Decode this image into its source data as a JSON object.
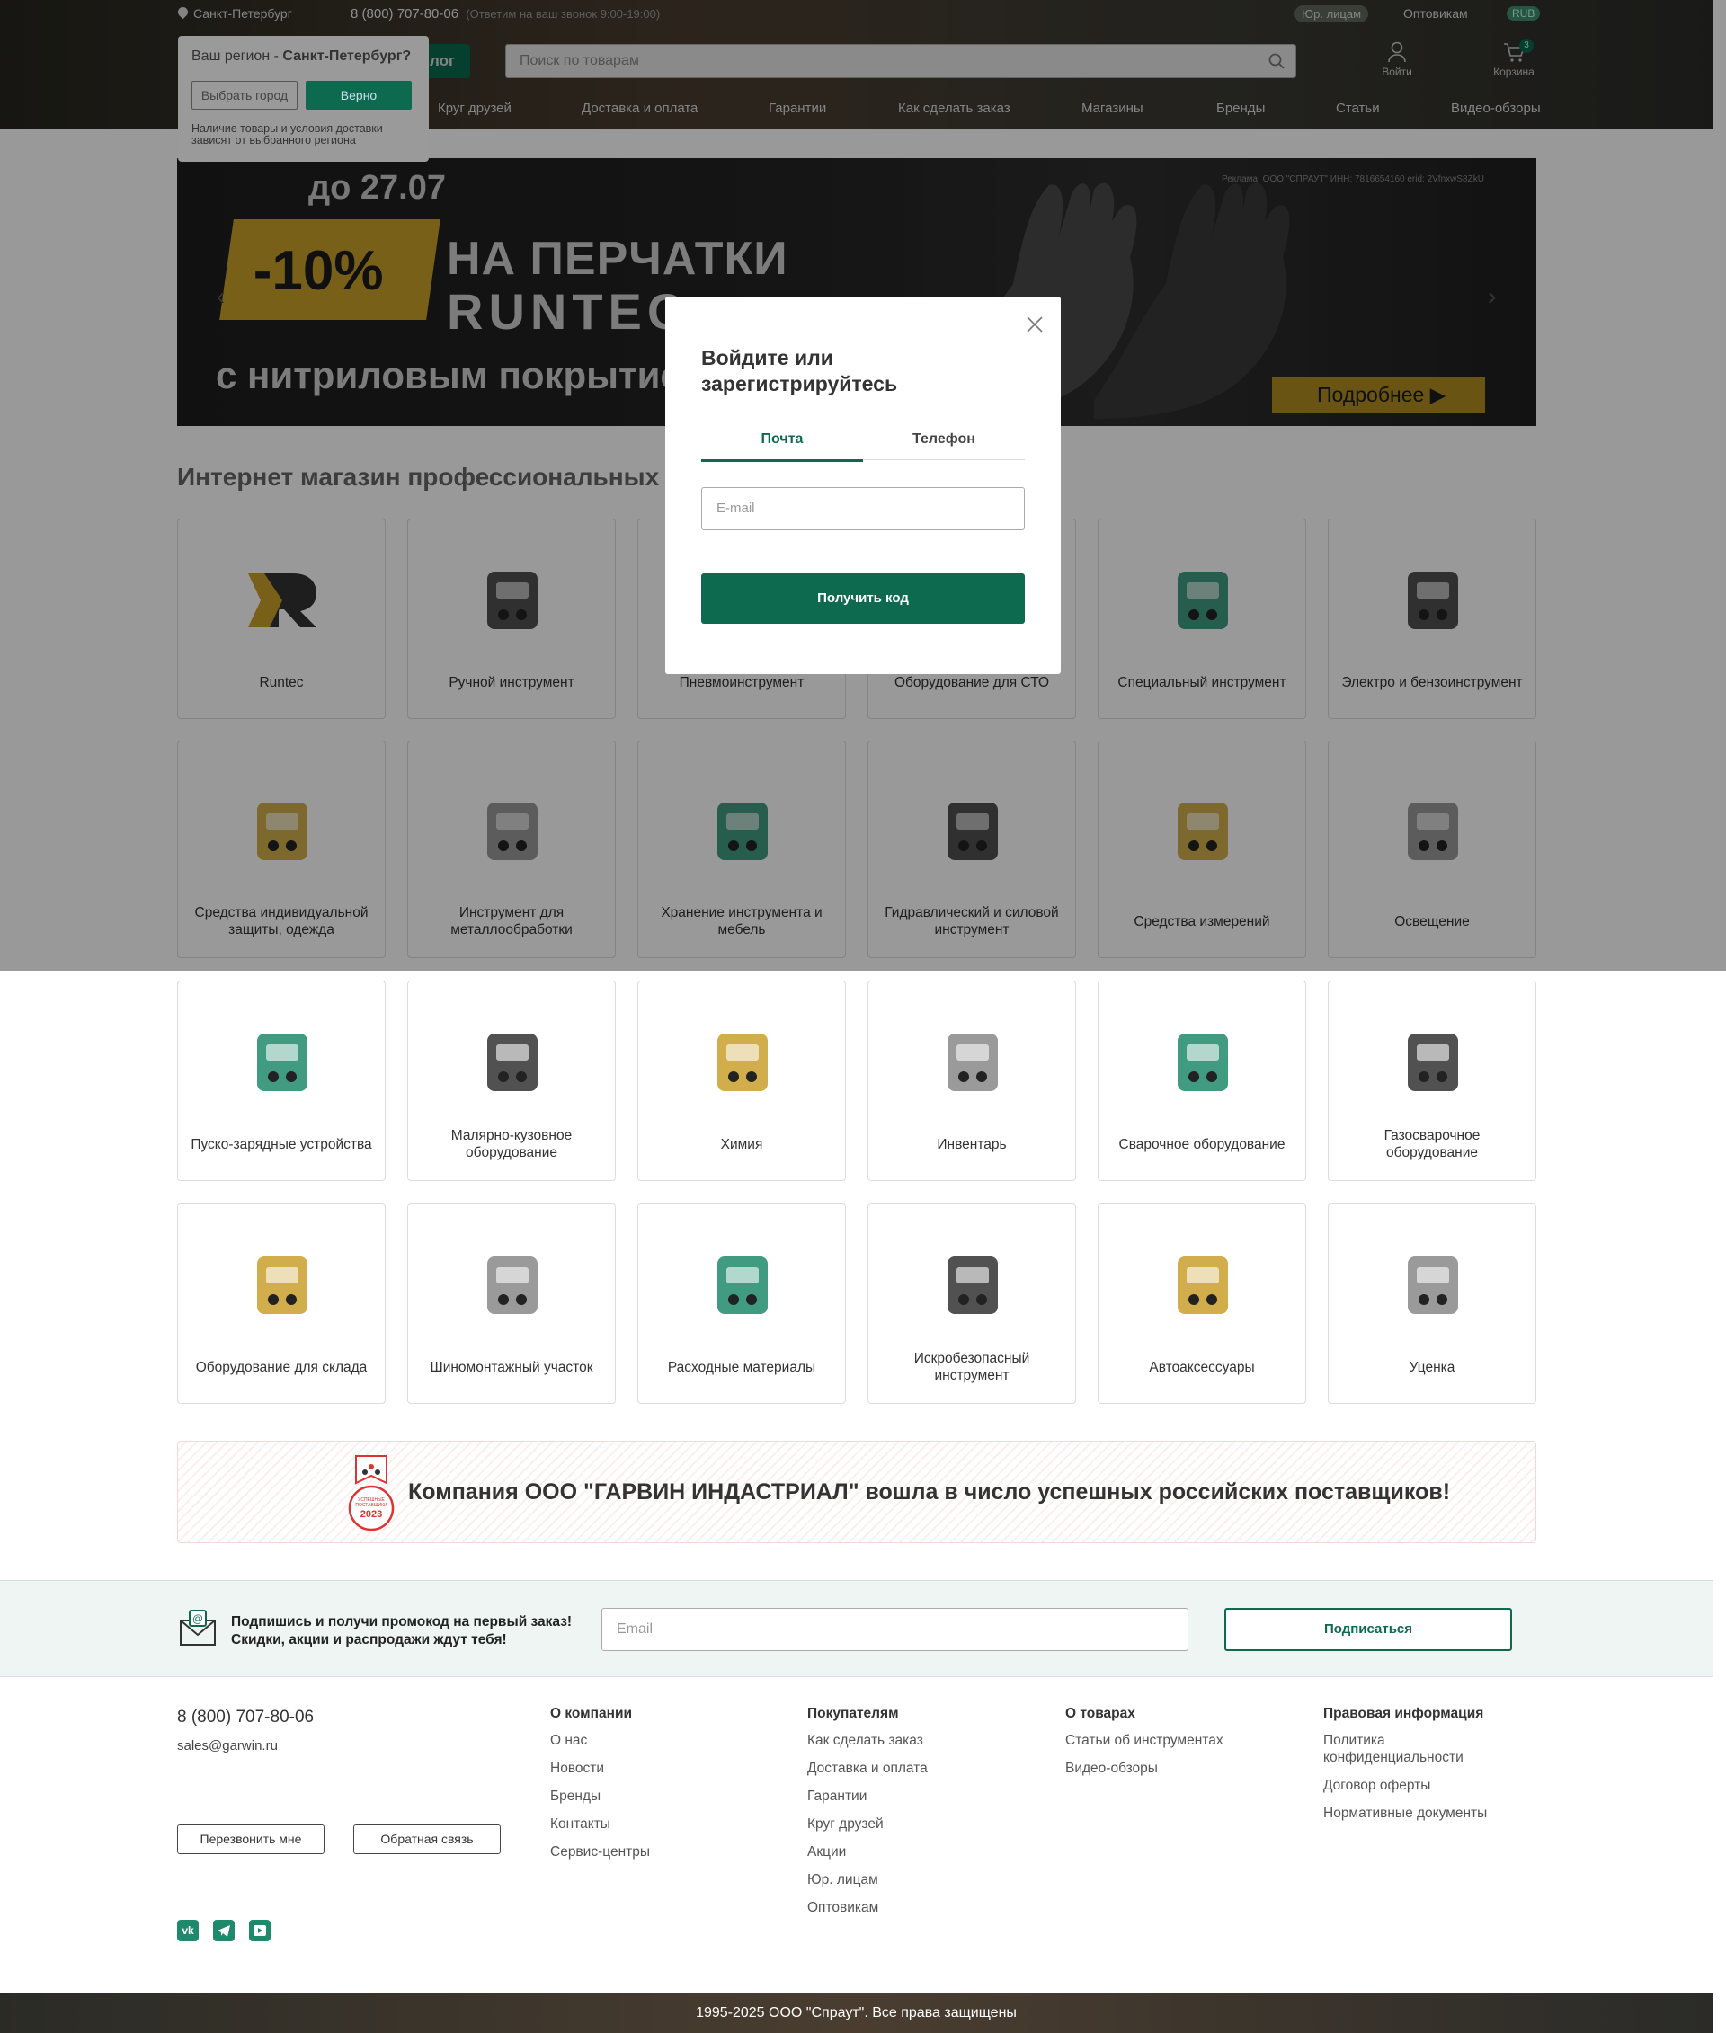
{
  "header": {
    "city": "Санкт-Петербург",
    "phone": "8 (800) 707-80-06",
    "hours": "(Ответим на ваш звонок 9:00-19:00)",
    "legal_entities": "Юр. лицам",
    "wholesale": "Оптовикам",
    "currency": "RUB",
    "catalog": "лог",
    "search_placeholder": "Поиск по товарам",
    "login": "Войти",
    "cart": "Корзина",
    "cart_count": "3",
    "nav": [
      "Круг друзей",
      "Доставка и оплата",
      "Гарантии",
      "Как сделать заказ",
      "Магазины",
      "Бренды",
      "Статьи",
      "Видео-обзоры"
    ]
  },
  "region_popup": {
    "question": "Ваш регион - ",
    "region": "Санкт-Петербург?",
    "choose": "Выбрать город",
    "confirm": "Верно",
    "note": "Наличие товары и условия доставки зависят от выбранного региона"
  },
  "banner": {
    "date": "до 27.07",
    "discount": "-10%",
    "line1": "НА ПЕРЧАТКИ",
    "line2": "RUNTEC",
    "line3": "с нитриловым покрытием",
    "ad": "Реклама. ООО \"СПРАУТ\" ИНН: 7816654160 erid: 2VfnxwS8ZkU",
    "more": "Подробнее ▶"
  },
  "headline": "Интернет магазин профессиональных инструментов",
  "categories": [
    "Runtec",
    "Ручной инструмент",
    "Пневмоинструмент",
    "Оборудование для СТО",
    "Специальный инструмент",
    "Электро и бензоинструмент",
    "Средства индивидуальной защиты, одежда",
    "Инструмент для металлообработки",
    "Хранение инструмента и мебель",
    "Гидравлический и силовой инструмент",
    "Средства измерений",
    "Освещение",
    "Пуско-зарядные устройства",
    "Малярно-кузовное оборудование",
    "Химия",
    "Инвентарь",
    "Сварочное оборудование",
    "Газосварочное оборудование",
    "Оборудование для склада",
    "Шиномонтажный участок",
    "Расходные материалы",
    "Искробезопасный инструмент",
    "Автоаксессуары",
    "Уценка"
  ],
  "modal": {
    "title": "Войдите или зарегистрируйтесь",
    "tab_email": "Почта",
    "tab_phone": "Телефон",
    "email_placeholder": "E-mail",
    "get_code": "Получить код"
  },
  "supplier": {
    "badge_line1": "УСПЕШНЫЕ ПОСТАВЩИКИ",
    "badge_year": "2023",
    "text": "Компания ООО \"ГАРВИН ИНДАСТРИАЛ\" вошла в число успешных российских поставщиков!"
  },
  "subscribe": {
    "line1": "Подпишись и получи промокод на первый заказ!",
    "line2": "Скидки, акции и распродажи ждут тебя!",
    "placeholder": "Email",
    "button": "Подписаться"
  },
  "footer": {
    "phone": "8 (800) 707-80-06",
    "email": "sales@garwin.ru",
    "callback": "Перезвонить мне",
    "feedback": "Обратная связь",
    "about": {
      "title": "О компании",
      "items": [
        "О нас",
        "Новости",
        "Бренды",
        "Контакты",
        "Сервис-центры"
      ]
    },
    "buyers": {
      "title": "Покупателям",
      "items": [
        "Как сделать заказ",
        "Доставка и оплата",
        "Гарантии",
        "Круг друзей",
        "Акции",
        "Юр. лицам",
        "Оптовикам"
      ]
    },
    "goods": {
      "title": "О товарах",
      "items": [
        "Статьи об инструментах",
        "Видео-обзоры"
      ]
    },
    "legal": {
      "title": "Правовая информация",
      "items": [
        "Политика конфиденциальности",
        "Договор оферты",
        "Нормативные документы"
      ]
    },
    "social": [
      "vk",
      "telegram",
      "youtube"
    ],
    "copyright": "1995-2025 ООО \"Спраут\". Все права защищены"
  },
  "colors": {
    "brand": "#0d6a4f",
    "accent": "#c9a02b"
  }
}
